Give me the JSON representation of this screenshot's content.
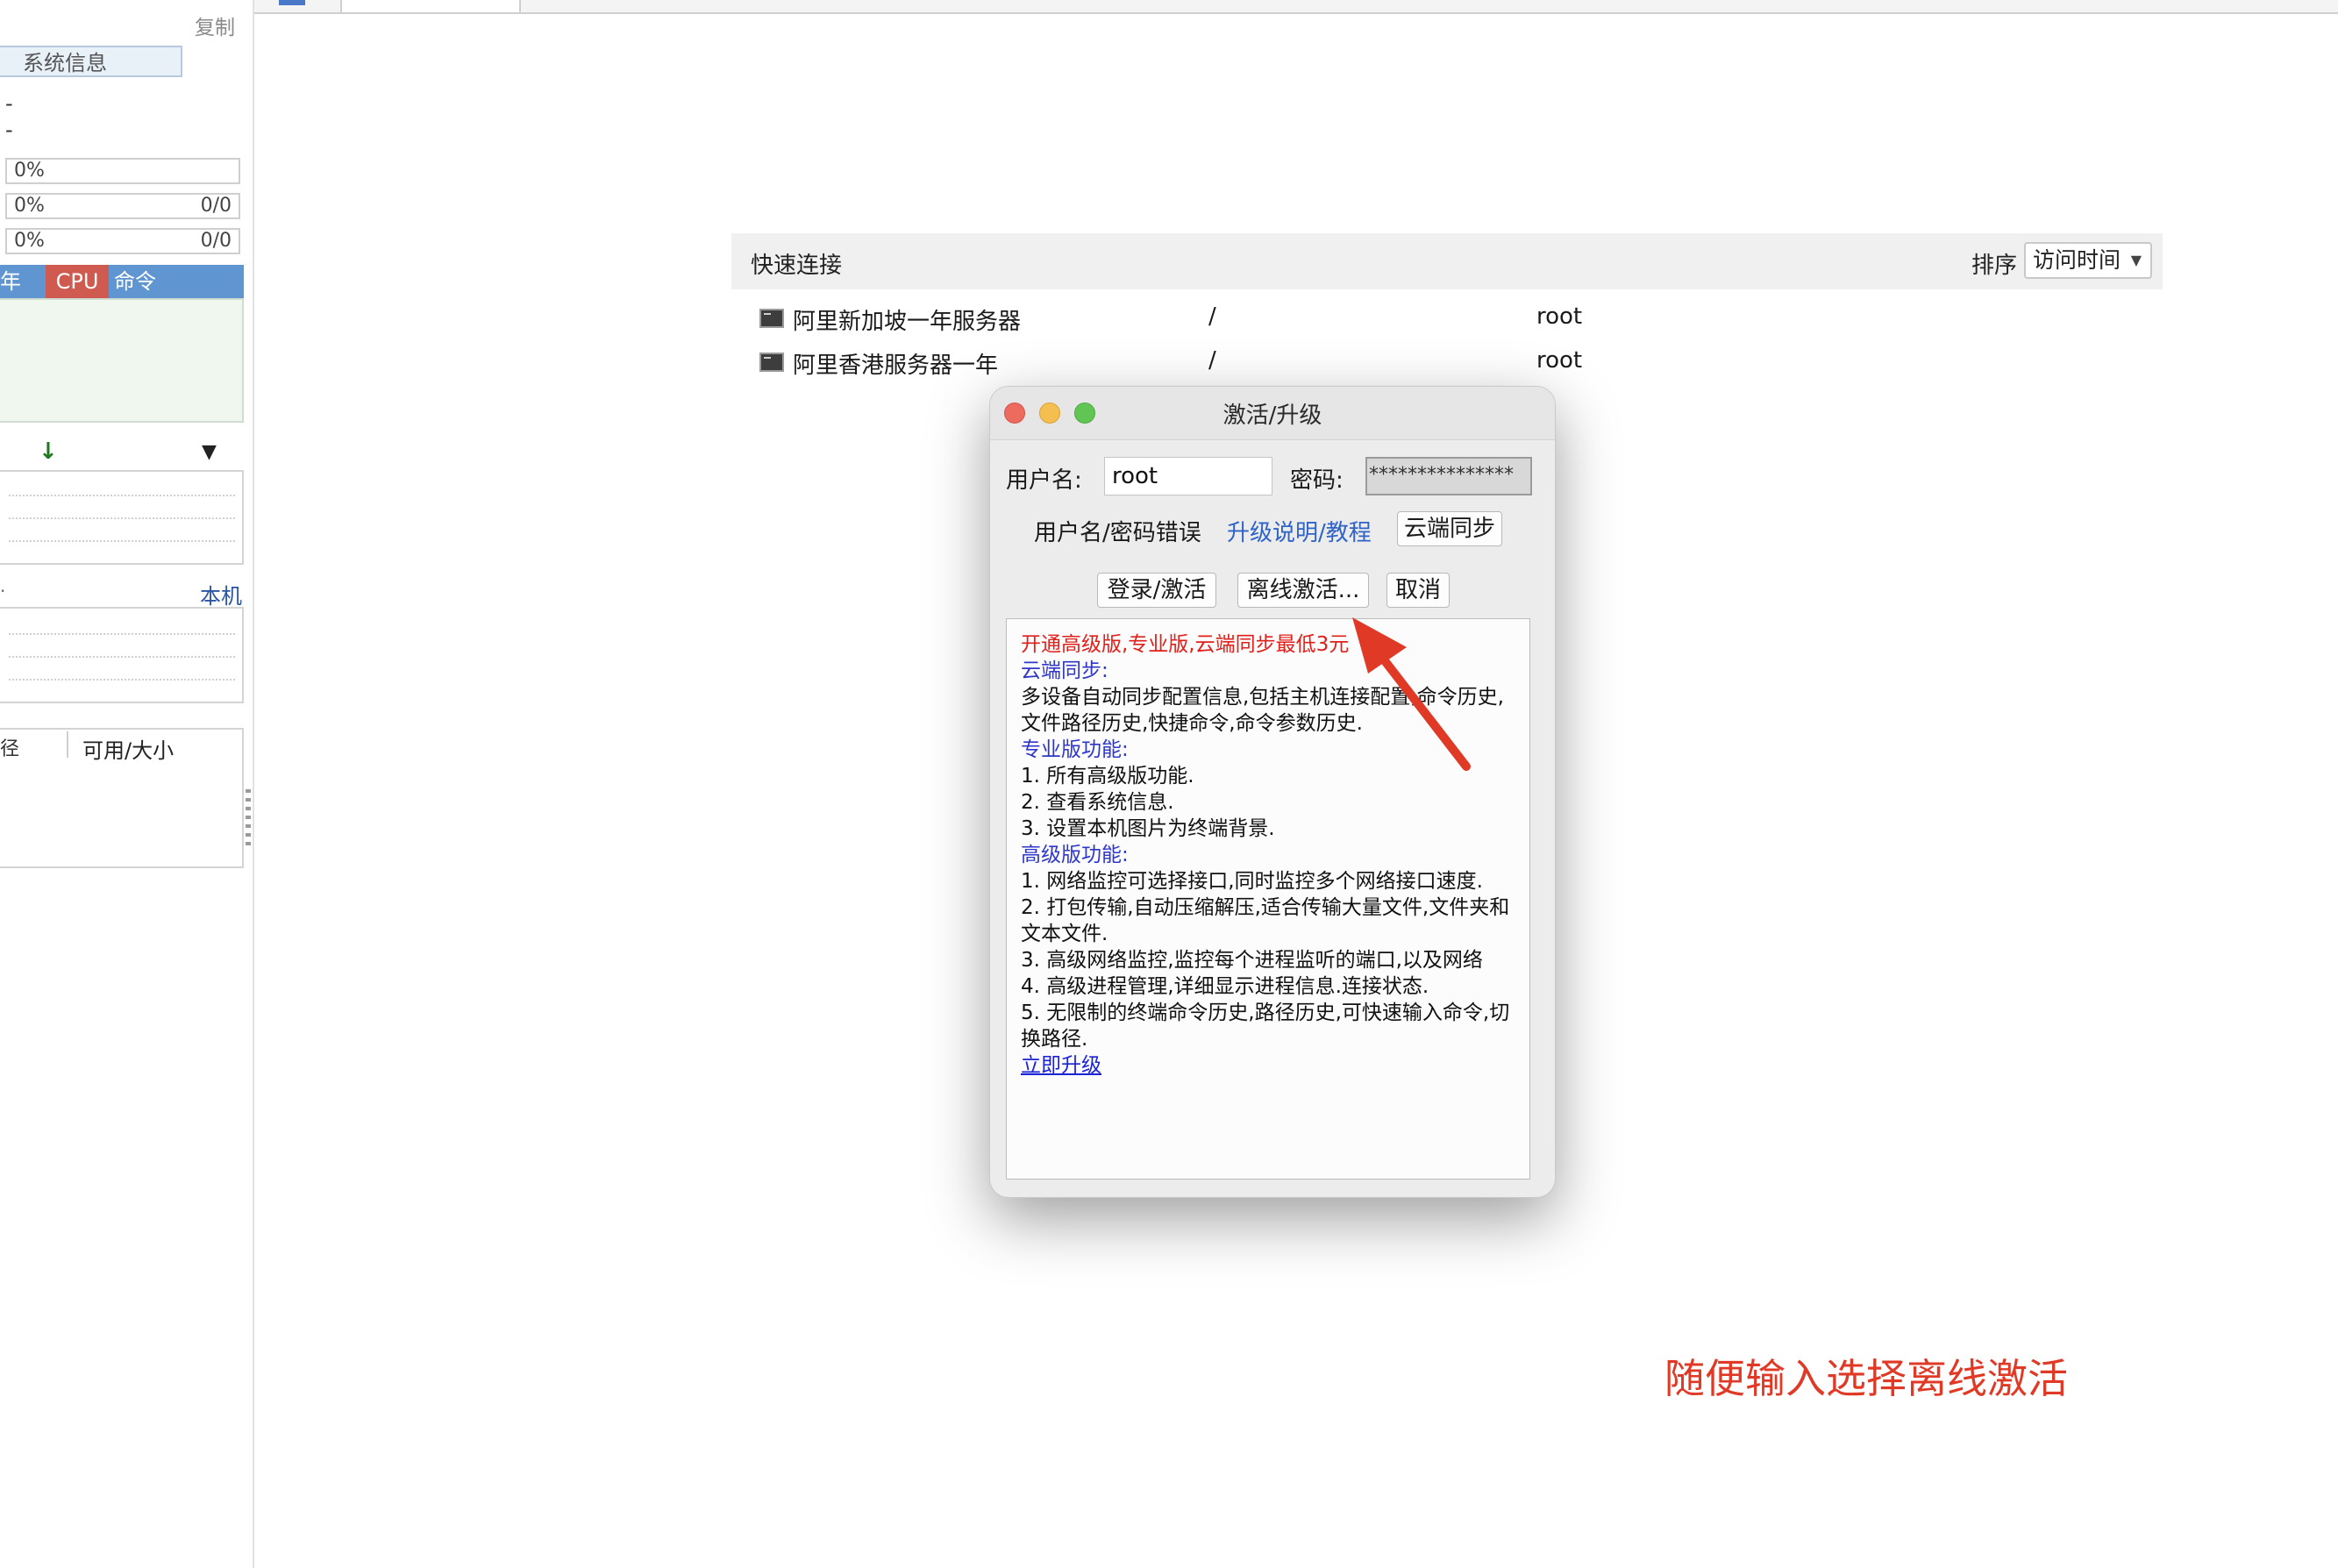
{
  "left_panel": {
    "copy_label": "复制",
    "sysinfo_button": "系统信息",
    "dash_1": "-",
    "dash_2": "-",
    "meters": [
      {
        "pct": "0%",
        "count": ""
      },
      {
        "pct": "0%",
        "count": "0/0"
      },
      {
        "pct": "0%",
        "count": "0/0"
      }
    ],
    "process_header": {
      "col0": "年",
      "cpu": "CPU",
      "cmd": "命令"
    },
    "local_label": "本机",
    "small_dot": "·",
    "disk_header": {
      "col0": "径",
      "col1": "可用/大小"
    }
  },
  "quick_connect": {
    "title": "快速连接",
    "sort_label": "排序",
    "sort_value": "访问时间",
    "servers": [
      {
        "name": "阿里新加坡一年服务器",
        "path": "/",
        "user": "root"
      },
      {
        "name": "阿里香港服务器一年",
        "path": "/",
        "user": "root"
      }
    ]
  },
  "dialog": {
    "title": "激活/升级",
    "username_label": "用户名:",
    "username_value": "root",
    "password_label": "密码:",
    "password_value": "***************",
    "error_text": "用户名/密码错误",
    "upgrade_link": "升级说明/教程",
    "cloud_sync_button": "云端同步",
    "login_button": "登录/激活",
    "offline_button": "离线激活...",
    "cancel_button": "取消",
    "info": {
      "promo": "开通高级版,专业版,云端同步最低3元",
      "cloud_title": "云端同步:",
      "cloud_desc": "多设备自动同步配置信息,包括主机连接配置,命令历史,文件路径历史,快捷命令,命令参数历史.",
      "pro_title": "专业版功能:",
      "pro_items": [
        "1. 所有高级版功能.",
        "2. 查看系统信息.",
        "3. 设置本机图片为终端背景."
      ],
      "adv_title": "高级版功能:",
      "adv_items": [
        "1. 网络监控可选择接口,同时监控多个网络接口速度.",
        "2. 打包传输,自动压缩解压,适合传输大量文件,文件夹和文本文件.",
        "3. 高级网络监控,监控每个进程监听的端口,以及网络",
        "4. 高级进程管理,详细显示进程信息.连接状态.",
        "5. 无限制的终端命令历史,路径历史,可快速输入命令,切换路径."
      ],
      "upgrade_now": "立即升级"
    }
  },
  "annotation": {
    "text": "随便输入选择离线激活",
    "color": "#e03a27"
  },
  "colors": {
    "process_header_bg": "#5f96d2",
    "cpu_header_bg": "#cf5b50",
    "link_blue": "#2f63c8",
    "promo_red": "#e0201a"
  }
}
